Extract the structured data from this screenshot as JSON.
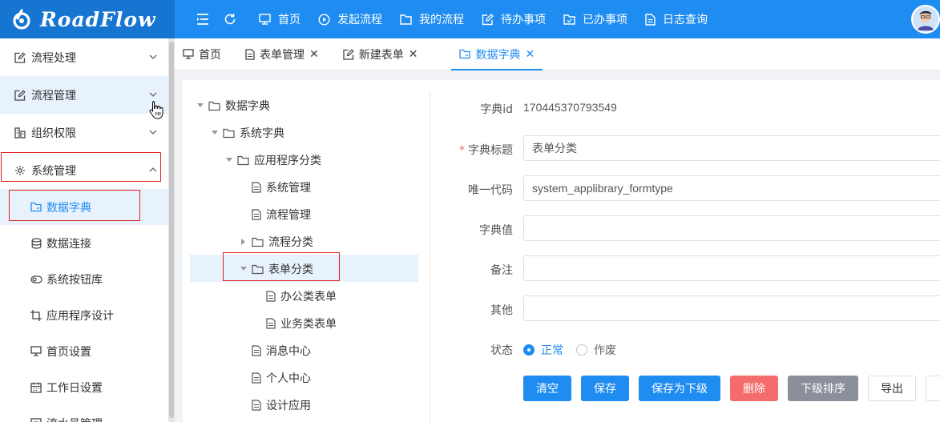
{
  "brand": {
    "name": "RoadFlow"
  },
  "topnav": [
    {
      "label": "首页",
      "icon": "monitor-icon"
    },
    {
      "label": "发起流程",
      "icon": "play-circle-icon"
    },
    {
      "label": "我的流程",
      "icon": "folder-icon"
    },
    {
      "label": "待办事项",
      "icon": "edit-icon"
    },
    {
      "label": "已办事项",
      "icon": "folder-check-icon"
    },
    {
      "label": "日志查询",
      "icon": "document-icon"
    }
  ],
  "sidebar": {
    "groups": [
      {
        "label": "流程处理",
        "icon": "edit-icon"
      },
      {
        "label": "流程管理",
        "icon": "edit-icon"
      },
      {
        "label": "组织权限",
        "icon": "org-icon"
      },
      {
        "label": "系统管理",
        "icon": "gear-icon"
      }
    ],
    "sub_items": [
      {
        "label": "数据字典",
        "icon": "folder-icon",
        "active": true
      },
      {
        "label": "数据连接",
        "icon": "database-icon"
      },
      {
        "label": "系统按钮库",
        "icon": "toggle-icon"
      },
      {
        "label": "应用程序设计",
        "icon": "crop-icon"
      },
      {
        "label": "首页设置",
        "icon": "monitor-icon"
      },
      {
        "label": "工作日设置",
        "icon": "calendar-icon"
      },
      {
        "label": "流水号管理",
        "icon": "list-icon"
      }
    ]
  },
  "tabs": [
    {
      "label": "首页",
      "icon": "monitor-icon",
      "closable": false
    },
    {
      "label": "表单管理",
      "icon": "document-icon",
      "closable": true
    },
    {
      "label": "新建表单",
      "icon": "edit-icon",
      "closable": true
    },
    {
      "label": "数据字典",
      "icon": "folder-icon",
      "closable": true,
      "active": true
    }
  ],
  "tree": [
    {
      "label": "数据字典",
      "type": "folder",
      "caret": "down",
      "level": 0
    },
    {
      "label": "系统字典",
      "type": "folder",
      "caret": "down",
      "level": 1
    },
    {
      "label": "应用程序分类",
      "type": "folder",
      "caret": "down",
      "level": 2
    },
    {
      "label": "系统管理",
      "type": "doc",
      "caret": "",
      "level": 3
    },
    {
      "label": "流程管理",
      "type": "doc",
      "caret": "",
      "level": 3
    },
    {
      "label": "流程分类",
      "type": "folder",
      "caret": "right",
      "level": 3
    },
    {
      "label": "表单分类",
      "type": "folder",
      "caret": "down",
      "level": 3,
      "selected": true
    },
    {
      "label": "办公类表单",
      "type": "doc",
      "caret": "",
      "level": 4
    },
    {
      "label": "业务类表单",
      "type": "doc",
      "caret": "",
      "level": 4
    },
    {
      "label": "消息中心",
      "type": "doc",
      "caret": "",
      "level": 3
    },
    {
      "label": "个人中心",
      "type": "doc",
      "caret": "",
      "level": 3
    },
    {
      "label": "设计应用",
      "type": "doc",
      "caret": "",
      "level": 3
    }
  ],
  "form": {
    "id_label": "字典id",
    "id_value": "170445370793549",
    "title_label": "字典标题",
    "title_required": "*",
    "title_value": "表单分类",
    "code_label": "唯一代码",
    "code_value": "system_applibrary_formtype",
    "value_label": "字典值",
    "value_value": "",
    "note_label": "备注",
    "note_value": "",
    "other_label": "其他",
    "other_value": "",
    "status_label": "状态",
    "status_options": [
      "正常",
      "作废"
    ],
    "status_selected": "正常"
  },
  "buttons": {
    "clear": "清空",
    "save": "保存",
    "save_child": "保存为下级",
    "delete": "删除",
    "sort_child": "下级排序",
    "export": "导出"
  },
  "colors": {
    "primary": "#1e8cf0",
    "header_logo_bg": "#1675d1",
    "danger": "#f56c6c",
    "neutral": "#8a8f99",
    "highlight_box": "#e02020"
  }
}
